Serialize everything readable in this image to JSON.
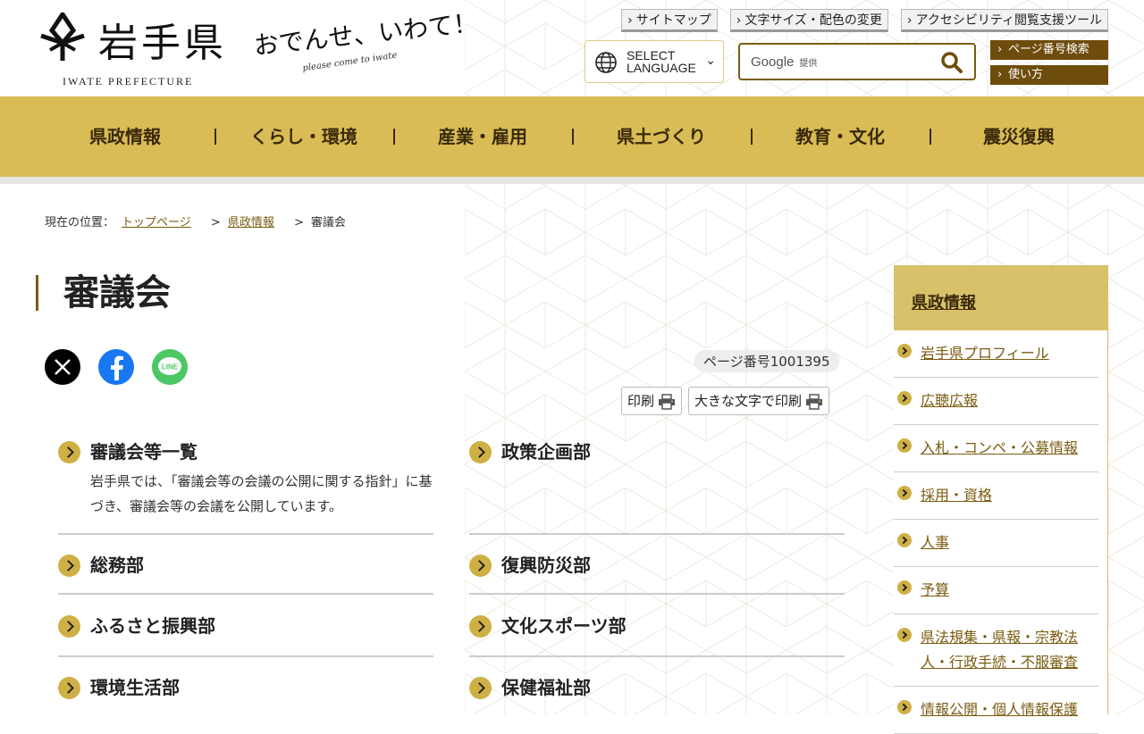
{
  "header": {
    "logo_title": "岩手県",
    "logo_en": "IWATE PREFECTURE",
    "catch_main": "おでんせ、いわて！",
    "catch_sub": "please come to iwate",
    "top_links": [
      "サイトマップ",
      "文字サイズ・配色の変更",
      "アクセシビリティ閲覧支援ツール"
    ],
    "language": "SELECT LANGUAGE",
    "search_brand": "Google",
    "search_brand_note": "提供",
    "page_no_search": "ページ番号検索",
    "usage": "使い方"
  },
  "nav": [
    "県政情報",
    "くらし・環境",
    "産業・雇用",
    "県土づくり",
    "教育・文化",
    "震災復興"
  ],
  "breadcrumb": {
    "label": "現在の位置：",
    "items": [
      "トップページ",
      "県政情報"
    ],
    "current": "審議会"
  },
  "page": {
    "title": "審議会",
    "page_number": "ページ番号1001395",
    "print": "印刷",
    "print_large": "大きな文字で印刷"
  },
  "categories": [
    {
      "title": "審議会等一覧",
      "desc": "岩手県では、「審議会等の会議の公開に関する指針」に基づき、審議会等の会議を公開しています。"
    },
    {
      "title": "政策企画部"
    },
    {
      "title": "総務部"
    },
    {
      "title": "復興防災部"
    },
    {
      "title": "ふるさと振興部"
    },
    {
      "title": "文化スポーツ部"
    },
    {
      "title": "環境生活部"
    },
    {
      "title": "保健福祉部"
    }
  ],
  "sidebar": {
    "title": "県政情報",
    "items": [
      "岩手県プロフィール",
      "広聴広報",
      "入札・コンペ・公募情報",
      "採用・資格",
      "人事",
      "予算",
      "県法規集・県報・宗教法人・行政手続・不服審査",
      "情報公開・個人情報保護"
    ]
  },
  "colors": {
    "gold": "#d9bc55",
    "brown": "#6e4c0c",
    "link": "#7a5c10"
  },
  "icons": {
    "x": "x-logo-icon",
    "facebook": "facebook-icon",
    "line": "line-icon",
    "search": "search-icon",
    "globe": "globe-icon",
    "print": "printer-icon"
  }
}
